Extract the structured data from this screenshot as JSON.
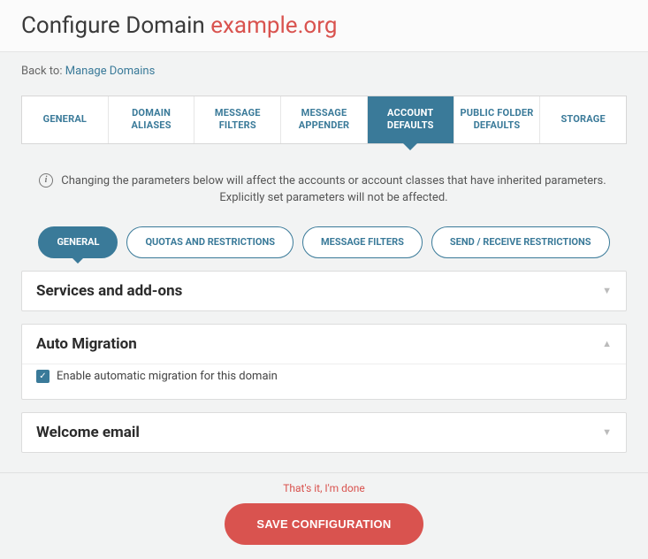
{
  "header": {
    "title_prefix": "Configure Domain",
    "domain_name": "example.org"
  },
  "breadcrumb": {
    "back_label": "Back to:",
    "link_label": "Manage Domains"
  },
  "tabs": [
    {
      "label": "GENERAL"
    },
    {
      "label": "DOMAIN ALIASES"
    },
    {
      "label": "MESSAGE FILTERS"
    },
    {
      "label": "MESSAGE APPENDER"
    },
    {
      "label": "ACCOUNT DEFAULTS"
    },
    {
      "label": "PUBLIC FOLDER DEFAULTS"
    },
    {
      "label": "STORAGE"
    }
  ],
  "info_text": "Changing the parameters below will affect the accounts or account classes that have inherited parameters. Explicitly set parameters will not be affected.",
  "subTabs": [
    {
      "label": "GENERAL"
    },
    {
      "label": "QUOTAS AND RESTRICTIONS"
    },
    {
      "label": "MESSAGE FILTERS"
    },
    {
      "label": "SEND / RECEIVE RESTRICTIONS"
    }
  ],
  "panels": {
    "services": {
      "title": "Services and add-ons"
    },
    "auto_migration": {
      "title": "Auto Migration",
      "checkbox_label": "Enable automatic migration for this domain"
    },
    "welcome": {
      "title": "Welcome email"
    }
  },
  "footer": {
    "done_text": "That's it, I'm done",
    "save_label": "SAVE CONFIGURATION"
  }
}
